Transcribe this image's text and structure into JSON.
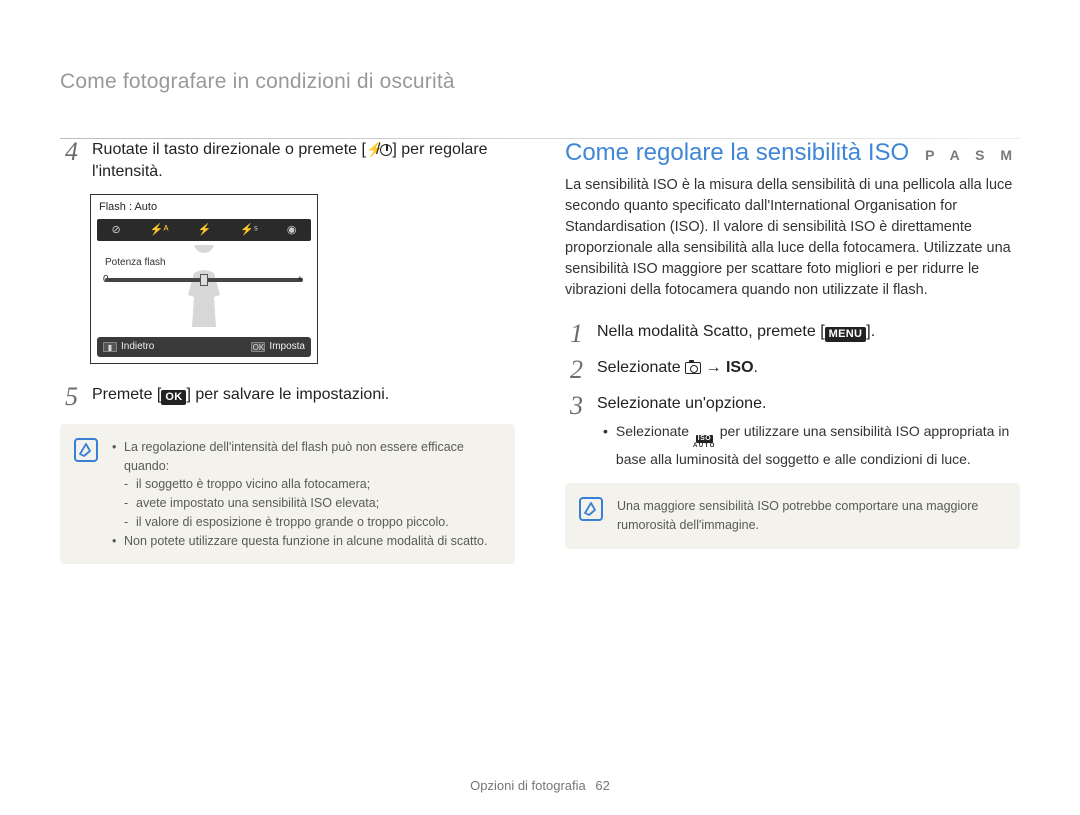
{
  "header": {
    "breadcrumb": "Come fotografare in condizioni di oscurità"
  },
  "left": {
    "step4": {
      "num": "4",
      "text_a": "Ruotate il tasto direzionale o premete [",
      "text_b": "] per regolare l'intensità."
    },
    "lcd": {
      "top_label": "Flash : Auto",
      "option_label": "Potenza flash",
      "slider_min": "0",
      "slider_max": "+",
      "back_label": "Indietro",
      "set_label": "Imposta",
      "ok_sym": "OK"
    },
    "step5": {
      "num": "5",
      "text_a": "Premete [",
      "ok": "OK",
      "text_b": "] per salvare le impostazioni."
    },
    "note": {
      "lines": [
        "La regolazione dell'intensità del flash può non essere efficace quando:",
        "il soggetto è troppo vicino alla fotocamera;",
        "avete impostato una sensibilità ISO elevata;",
        "il valore di esposizione è troppo grande o troppo piccolo.",
        "Non potete utilizzare questa funzione in alcune modalità di scatto."
      ]
    }
  },
  "right": {
    "title": "Come regolare la sensibilità ISO",
    "modes": "P A S M",
    "para": "La sensibilità ISO è la misura della sensibilità di una pellicola alla luce secondo quanto specificato dall'International Organisation for Standardisation (ISO). Il valore di sensibilità ISO è direttamente proporzionale alla sensibilità alla luce della fotocamera. Utilizzate una sensibilità ISO maggiore per scattare foto migliori e per ridurre le vibrazioni della fotocamera quando non utilizzate il flash.",
    "step1": {
      "num": "1",
      "text_a": "Nella modalità Scatto, premete [",
      "menu": "MENU",
      "text_b": "]."
    },
    "step2": {
      "num": "2",
      "text_a": "Selezionate ",
      "arrow": " → ",
      "iso": "ISO",
      "dot": "."
    },
    "step3": {
      "num": "3",
      "text": "Selezionate un'opzione.",
      "sub_a": "Selezionate ",
      "sub_b": " per utilizzare una sensibilità ISO appropriata in base alla luminosità del soggetto e alle condizioni di luce."
    },
    "note": "Una maggiore sensibilità ISO potrebbe comportare una maggiore rumorosità dell'immagine."
  },
  "footer": {
    "section": "Opzioni di fotografia",
    "page": "62"
  }
}
